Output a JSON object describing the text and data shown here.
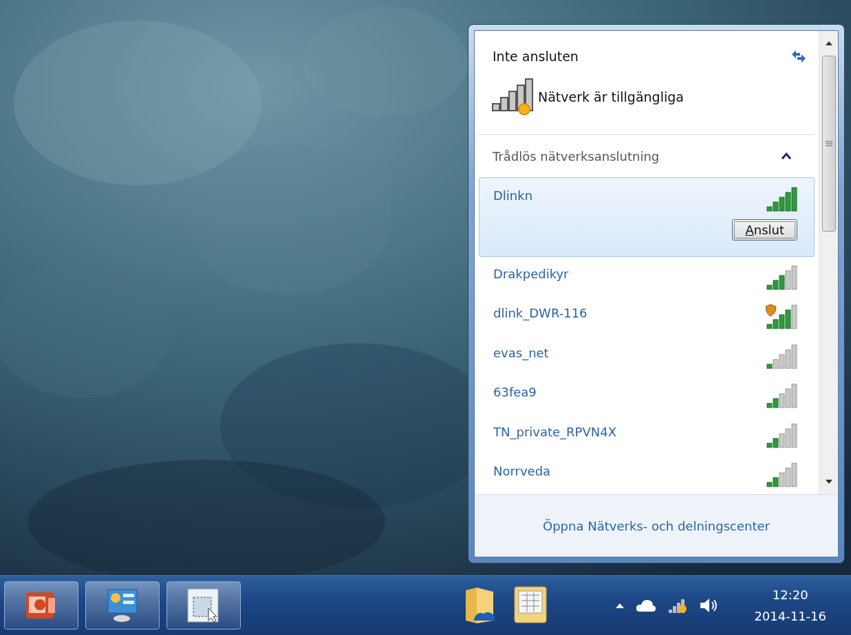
{
  "status": {
    "title": "Inte ansluten",
    "message": "Nätverk är tillgängliga"
  },
  "section": {
    "title": "Trådlös nätverksanslutning",
    "expanded": true
  },
  "networks": [
    {
      "name": "Dlinkn",
      "kind": "excellent",
      "selected": true,
      "warning": false
    },
    {
      "name": "Drakpedikyr",
      "kind": "good",
      "selected": false,
      "warning": false
    },
    {
      "name": "dlink_DWR-116",
      "kind": "very-good",
      "selected": false,
      "warning": true
    },
    {
      "name": "evas_net",
      "kind": "poor",
      "selected": false,
      "warning": false
    },
    {
      "name": "63fea9",
      "kind": "fair",
      "selected": false,
      "warning": false
    },
    {
      "name": "TN_private_RPVN4X",
      "kind": "fair",
      "selected": false,
      "warning": false
    },
    {
      "name": "Norrveda",
      "kind": "fair",
      "selected": false,
      "warning": false
    }
  ],
  "connect_button": {
    "label": "Anslut"
  },
  "footer_link": "Öppna Nätverks- och delningscenter",
  "clock": {
    "time": "12:20",
    "date": "2014-11-16"
  }
}
